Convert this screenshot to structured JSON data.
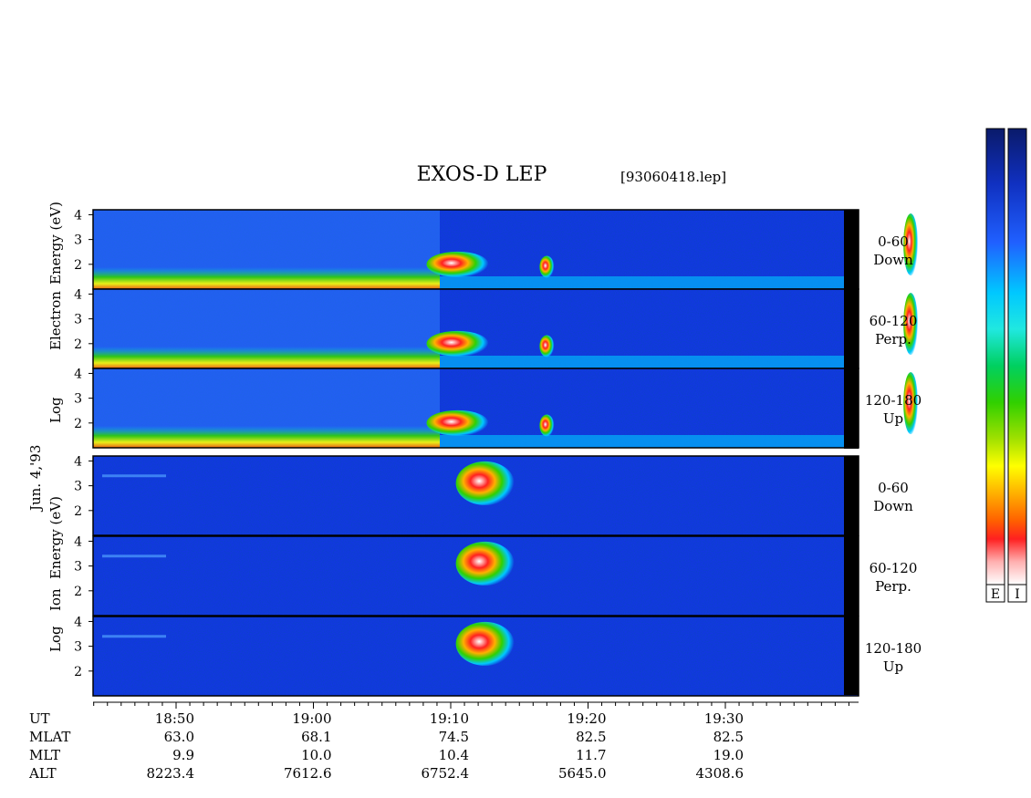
{
  "header": {
    "title": "EXOS-D LEP",
    "filename": "[93060418.lep]"
  },
  "date_label": "Jun. 4,'93",
  "colorbars": {
    "electron_label": "E",
    "ion_label": "I",
    "colors": [
      "#0a1a6a",
      "#1030c0",
      "#2060ff",
      "#00c8ff",
      "#20e8e0",
      "#00d060",
      "#30d000",
      "#a0e000",
      "#ffff00",
      "#ffb000",
      "#ff6000",
      "#ff2020",
      "#ffb0b0",
      "#ffffff"
    ]
  },
  "electron_section": {
    "axis_title": [
      "Log",
      "Electron",
      "Energy (eV)"
    ],
    "panels": [
      {
        "range": "0-60",
        "dir": "Down"
      },
      {
        "range": "60-120",
        "dir": "Perp."
      },
      {
        "range": "120-180",
        "dir": "Up"
      }
    ]
  },
  "ion_section": {
    "axis_title": [
      "Log",
      "Ion",
      "Energy (eV)"
    ],
    "panels": [
      {
        "range": "0-60",
        "dir": "Down"
      },
      {
        "range": "60-120",
        "dir": "Perp."
      },
      {
        "range": "120-180",
        "dir": "Up"
      }
    ]
  },
  "ephemeris": {
    "labels": [
      "UT",
      "MLAT",
      "MLT",
      "ALT"
    ],
    "rows": [
      {
        "ut": "18:50",
        "mlat": "63.0",
        "mlt": "9.9",
        "alt": "8223.4"
      },
      {
        "ut": "19:00",
        "mlat": "68.1",
        "mlt": "10.0",
        "alt": "7612.6"
      },
      {
        "ut": "19:10",
        "mlat": "74.5",
        "mlt": "10.4",
        "alt": "6752.4"
      },
      {
        "ut": "19:20",
        "mlat": "82.5",
        "mlt": "11.7",
        "alt": "5645.0"
      },
      {
        "ut": "19:30",
        "mlat": "82.5",
        "mlt": "19.0",
        "alt": "4308.6"
      }
    ]
  },
  "chart_data": {
    "type": "heatmap",
    "title": "EXOS-D LEP",
    "xlabel": "UT",
    "ylabel": "Log Energy (eV)",
    "x_ticks": [
      "18:50",
      "19:00",
      "19:10",
      "19:20",
      "19:30"
    ],
    "y_ticks": [
      2,
      3,
      4
    ],
    "ylim": [
      1,
      4.2
    ],
    "panels": [
      {
        "species": "Electron",
        "pitch_angle": "0-60",
        "dir": "Down"
      },
      {
        "species": "Electron",
        "pitch_angle": "60-120",
        "dir": "Perp."
      },
      {
        "species": "Electron",
        "pitch_angle": "120-180",
        "dir": "Up"
      },
      {
        "species": "Ion",
        "pitch_angle": "0-60",
        "dir": "Down"
      },
      {
        "species": "Ion",
        "pitch_angle": "60-120",
        "dir": "Perp."
      },
      {
        "species": "Ion",
        "pitch_angle": "120-180",
        "dir": "Up"
      }
    ]
  }
}
